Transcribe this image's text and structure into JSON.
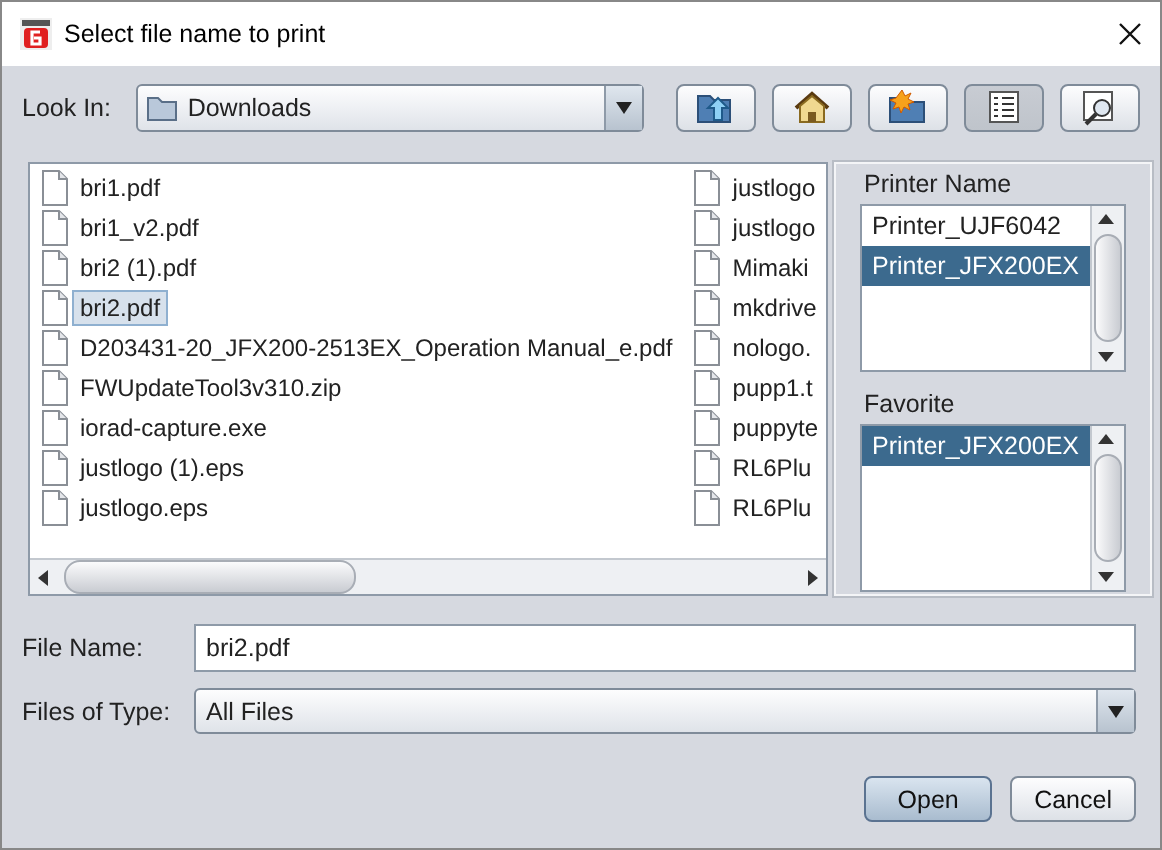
{
  "window": {
    "title": "Select file name to print"
  },
  "look_in": {
    "label": "Look In:",
    "value": "Downloads"
  },
  "toolbar": [
    {
      "kind": "up",
      "selected": false
    },
    {
      "kind": "home",
      "selected": false
    },
    {
      "kind": "new_folder",
      "selected": false
    },
    {
      "kind": "list",
      "selected": true
    },
    {
      "kind": "details",
      "selected": false
    }
  ],
  "files": {
    "columns": [
      [
        {
          "name": "bri1.pdf",
          "selected": false
        },
        {
          "name": "bri1_v2.pdf",
          "selected": false
        },
        {
          "name": "bri2 (1).pdf",
          "selected": false
        },
        {
          "name": "bri2.pdf",
          "selected": true
        },
        {
          "name": "D203431-20_JFX200-2513EX_Operation Manual_e.pdf",
          "selected": false
        },
        {
          "name": "FWUpdateTool3v310.zip",
          "selected": false
        },
        {
          "name": "iorad-capture.exe",
          "selected": false
        },
        {
          "name": "justlogo (1).eps",
          "selected": false
        },
        {
          "name": "justlogo.eps",
          "selected": false
        }
      ],
      [
        {
          "name": "justlogo",
          "selected": false
        },
        {
          "name": "justlogo",
          "selected": false
        },
        {
          "name": "Mimaki",
          "selected": false
        },
        {
          "name": "mkdrive",
          "selected": false
        },
        {
          "name": "nologo.",
          "selected": false
        },
        {
          "name": "pupp1.t",
          "selected": false
        },
        {
          "name": "puppyte",
          "selected": false
        },
        {
          "name": "RL6Plu",
          "selected": false
        },
        {
          "name": "RL6Plu",
          "selected": false
        }
      ]
    ]
  },
  "printer_name": {
    "label": "Printer Name",
    "items": [
      {
        "name": "Printer_UJF6042",
        "selected": false
      },
      {
        "name": "Printer_JFX200EX",
        "selected": true
      }
    ]
  },
  "favorite": {
    "label": "Favorite",
    "items": [
      {
        "name": "Printer_JFX200EX",
        "selected": true
      }
    ]
  },
  "file_name": {
    "label": "File Name:",
    "value": "bri2.pdf"
  },
  "file_type": {
    "label": "Files of Type:",
    "value": "All Files"
  },
  "buttons": [
    {
      "label": "Open",
      "default": true
    },
    {
      "label": "Cancel",
      "default": false
    }
  ]
}
